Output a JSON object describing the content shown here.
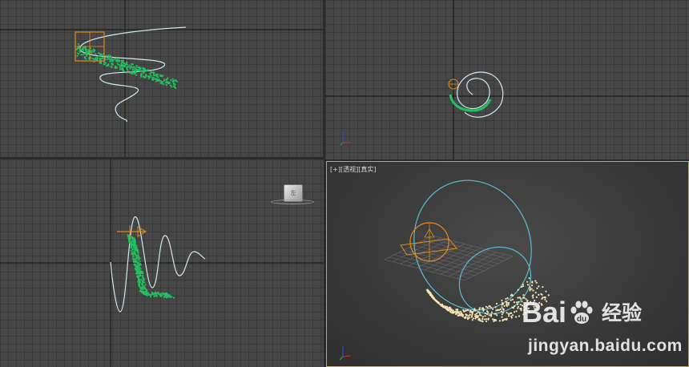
{
  "viewports": {
    "top": {},
    "front": {},
    "left": {
      "viewcube_label": "左"
    },
    "perspective": {
      "label_plus": "[+]",
      "label_view": "[透视]",
      "label_shading": "[真实]"
    }
  },
  "watermark": {
    "brand_bai": "Bai",
    "brand_du": "du",
    "brand_jingyan": "经验",
    "url": "jingyan.baidu.com"
  },
  "colors": {
    "particles": "#22c060",
    "particles_render": "#f2e3b2",
    "spline": "#cfe8f0",
    "helper": "#e08a1e",
    "active_border": "#c8a64a"
  },
  "icons": [
    "axis-tripod-icon",
    "viewcube-icon",
    "baidu-paw-icon"
  ]
}
